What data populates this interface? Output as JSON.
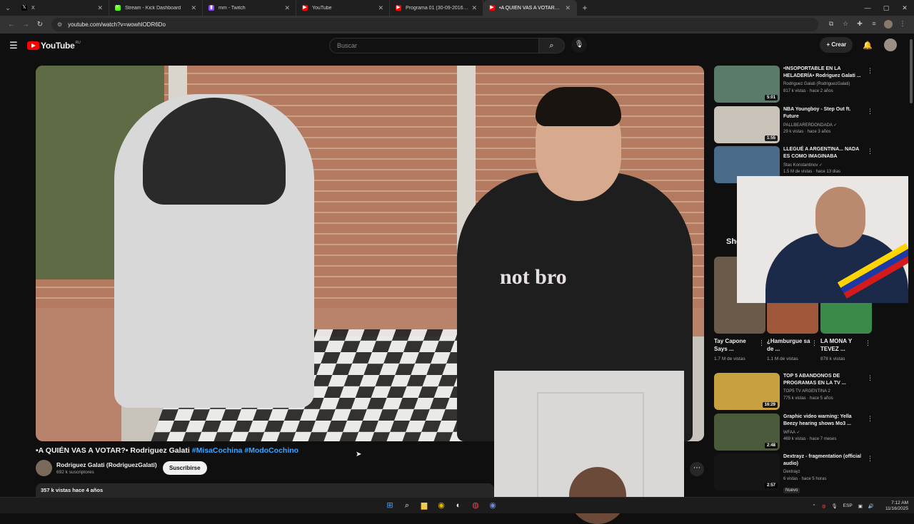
{
  "browser": {
    "tabs": [
      {
        "title": "X",
        "icon": "x-logo-icon",
        "color": "#000000",
        "glyph": "𝕏"
      },
      {
        "title": "Stream - Kick Dashboard",
        "icon": "kick-icon",
        "color": "#53fc18",
        "glyph": "K"
      },
      {
        "title": "mm - Twitch",
        "icon": "twitch-icon",
        "color": "#9146ff",
        "glyph": "▮"
      },
      {
        "title": "YouTube",
        "icon": "youtube-icon",
        "color": "#ff0000",
        "glyph": "▶"
      },
      {
        "title": "Programa 01 (30-09-2016) - Pe",
        "icon": "youtube-icon",
        "color": "#ff0000",
        "glyph": "▶"
      },
      {
        "title": "•A QUIÉN VAS A VOTAR?• Rodr",
        "icon": "youtube-icon",
        "color": "#ff0000",
        "glyph": "▶",
        "active": true
      }
    ],
    "url": "youtube.com/watch?v=wowhlODR6Do"
  },
  "youtube": {
    "logo_text": "YouTube",
    "country_code": "RU",
    "search_placeholder": "Buscar",
    "create_label": "Crear"
  },
  "video": {
    "title_prefix": "•A QUIÉN VAS A VOTAR?• Rodriguez Galati",
    "hashtags": "#MisaCochina #ModoCochino",
    "channel": "Rodriguez Galati (RodriguezGalati)",
    "subscribers": "692 k suscriptores",
    "subscribe_label": "Suscribirse",
    "views_date": "357 k vistas  hace 4 años"
  },
  "recommendations": [
    {
      "title": "•INSOPORTABLE EN LA HELADERÍA• Rodriguez Galati ...",
      "channel": "Rodriguez Galati (RodriguezGalati)",
      "meta": "817 k vistas · hace 2 años",
      "duration": "5:01",
      "thumb_color": "#5a7a6a"
    },
    {
      "title": "NBA Youngboy - Step Out ft. Future",
      "channel": "PALLBEARERDONDADA ✓",
      "meta": "29 k vistas · hace 3 años",
      "duration": "1:55",
      "thumb_color": "#c9c2b8"
    },
    {
      "title": "LLEGUÉ A ARGENTINA... NADA ES COMO IMAGINABA",
      "channel": "Stas Konstantinov ✓",
      "meta": "1.5 M de vistas · hace 13 días",
      "duration": "",
      "thumb_color": "#4a6a8a"
    },
    {
      "title": "TOP 5 ABANDONOS DE PROGRAMAS EN LA TV ...",
      "channel": "TOP5 TV ARGENTINA 2",
      "meta": "775 k vistas · hace 5 años",
      "duration": "16:29",
      "thumb_color": "#c8a040"
    },
    {
      "title": "Graphic video warning: Yella Beezy hearing shows Mo3 ...",
      "channel": "WFAA ✓",
      "meta": "469 k vistas · hace 7 meses",
      "duration": "2:48",
      "thumb_color": "#4a5a3a"
    },
    {
      "title": "Dextrayz - fragmentation (official audio)",
      "channel": "Dextrayz",
      "meta": "6 vistas · hace 5 horas",
      "duration": "2:57",
      "thumb_color": "#151515"
    }
  ],
  "shorts": {
    "header": "Shorts",
    "items": [
      {
        "title": "Tay Capone Says ...",
        "views": "1.7 M de vistas",
        "color": "#6a5a4a"
      },
      {
        "title": "¿Hamburgue sa de ...",
        "views": "1.1 M de vistas",
        "color": "#a0583a"
      },
      {
        "title": "LA MONA Y TEVEZ ...",
        "views": "878 k vistas",
        "color": "#3a8a4a"
      }
    ]
  },
  "new_badge": "Nuevo",
  "pip_overlay_text": "not bro",
  "taskbar": {
    "lang": "ESP",
    "time": "7:12 AM",
    "date": "11/16/2025"
  }
}
